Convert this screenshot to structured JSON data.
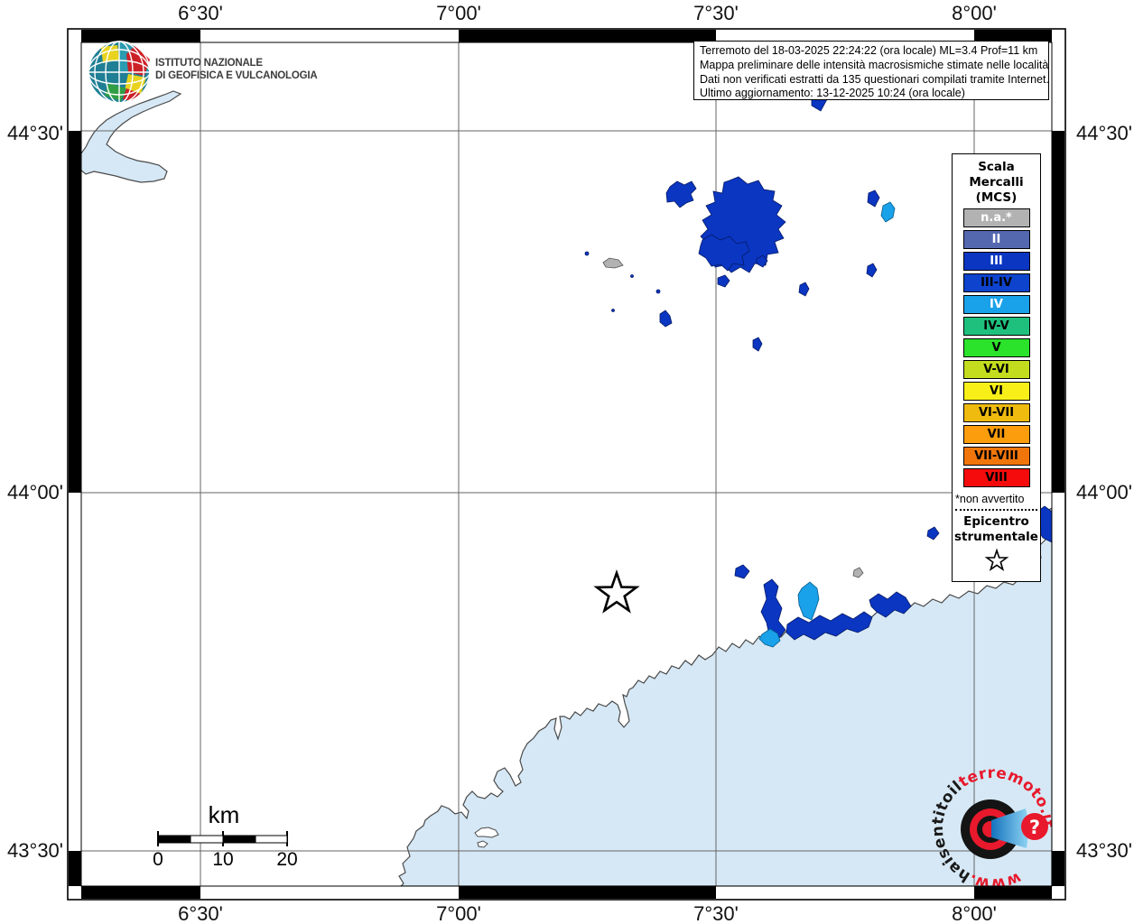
{
  "header": {
    "logo_line1": "ISTITUTO NAZIONALE",
    "logo_line2": "DI GEOFISICA E VULCANOLOGIA",
    "info_lines": [
      "Terremoto del 18-03-2025 22:24:22 (ora locale) ML=3.4 Prof=11 km",
      "Mappa preliminare delle intensità macrosismiche stimate nelle località",
      "Dati non verificati estratti da 135 questionari compilati tramite Internet.",
      "Ultimo aggiornamento: 13-12-2025 10:24 (ora locale)"
    ]
  },
  "axes": {
    "lon": [
      "6°30'",
      "7°00'",
      "7°30'",
      "8°00'"
    ],
    "lat": [
      "44°30'",
      "44°00'",
      "43°30'"
    ]
  },
  "legend": {
    "title_lines": [
      "Scala",
      "Mercalli",
      "(MCS)"
    ],
    "items": [
      {
        "label": "n.a.*",
        "color": "#b2b2b2",
        "text_color": "#ffffff"
      },
      {
        "label": "II",
        "color": "#5468b0",
        "text_color": "#ffffff"
      },
      {
        "label": "III",
        "color": "#0a36c2",
        "text_color": "#ffffff"
      },
      {
        "label": "III-IV",
        "color": "#0d43cd",
        "text_color": "#000000"
      },
      {
        "label": "IV",
        "color": "#19a1e9",
        "text_color": "#ffffff"
      },
      {
        "label": "IV-V",
        "color": "#1fc07e",
        "text_color": "#000000"
      },
      {
        "label": "V",
        "color": "#2ae32a",
        "text_color": "#000000"
      },
      {
        "label": "V-VI",
        "color": "#c3dc1e",
        "text_color": "#000000"
      },
      {
        "label": "VI",
        "color": "#f8ef19",
        "text_color": "#000000"
      },
      {
        "label": "VI-VII",
        "color": "#eebb0e",
        "text_color": "#000000"
      },
      {
        "label": "VII",
        "color": "#fb9d0c",
        "text_color": "#000000"
      },
      {
        "label": "VII-VIII",
        "color": "#f0760b",
        "text_color": "#000000"
      },
      {
        "label": "VIII",
        "color": "#f50b0b",
        "text_color": "#000000"
      }
    ],
    "footnote": "*non avvertito",
    "epicenter_lines": [
      "Epicentro",
      "strumentale"
    ]
  },
  "scale_bar": {
    "unit": "km",
    "tick_0": "0",
    "tick_10": "10",
    "tick_20": "20"
  },
  "map": {
    "sea_color": "#d6e8f5",
    "land_color": "#ffffff",
    "coast_color": "#4a4a4a",
    "grid_color": "#666666"
  },
  "watermark": {
    "seg_www": "www.",
    "seg_black": "haisentitoil",
    "seg_red": "terremoto.it",
    "question_mark": "?",
    "accent": "#e8192c"
  }
}
